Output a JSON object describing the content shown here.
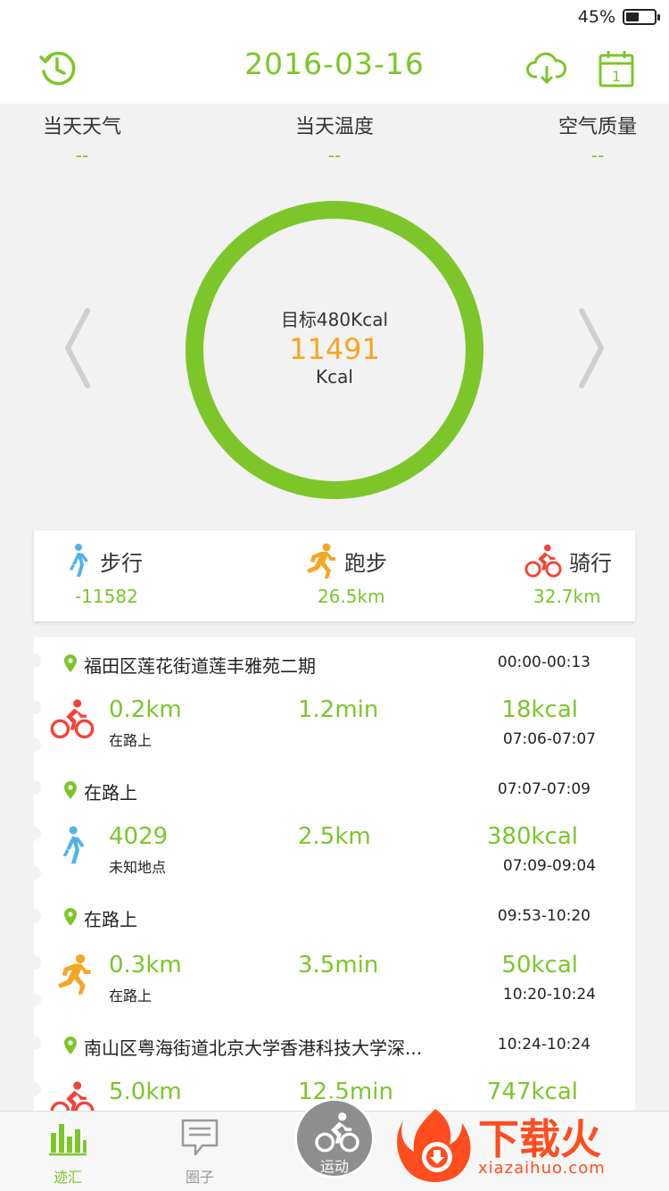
{
  "status": {
    "battery": "45%",
    "battery_level": 0.45
  },
  "header": {
    "date": "2016-03-16",
    "left_icon": "history-clock-icon",
    "right_icons": [
      "cloud-download-icon",
      "calendar-icon"
    ],
    "calendar_day": "1"
  },
  "weather": [
    {
      "label": "当天天气",
      "value": "--"
    },
    {
      "label": "当天温度",
      "value": "--"
    },
    {
      "label": "空气质量",
      "value": "--"
    }
  ],
  "calories": {
    "goal": "目标480Kcal",
    "value": "11491",
    "unit": "Kcal",
    "progress": 1.0
  },
  "summary": [
    {
      "icon": "walking-icon",
      "label": "步行",
      "value": "-11582",
      "color": "#4fb3e8"
    },
    {
      "icon": "running-icon",
      "label": "跑步",
      "value": "26.5km",
      "color": "#f5a623"
    },
    {
      "icon": "cycling-icon",
      "label": "骑行",
      "value": "32.7km",
      "color": "#f44336"
    }
  ],
  "timeline": [
    {
      "location": "福田区莲花街道莲丰雅苑二期",
      "loc_time": "00:00-00:13",
      "activity": {
        "icon": "cycling-icon",
        "main": "0.2km",
        "sub": "在路上",
        "mid": "1.2min",
        "right": "18kcal",
        "time": "07:06-07:07"
      }
    },
    {
      "location": "在路上",
      "loc_time": "07:07-07:09",
      "activity": {
        "icon": "walking-icon",
        "main": "4029",
        "sub": "未知地点",
        "mid": "2.5km",
        "right": "380kcal",
        "time": "07:09-09:04"
      }
    },
    {
      "location": "在路上",
      "loc_time": "09:53-10:20",
      "activity": {
        "icon": "running-icon",
        "main": "0.3km",
        "sub": "在路上",
        "mid": "3.5min",
        "right": "50kcal",
        "time": "10:20-10:24"
      }
    },
    {
      "location": "南山区粤海街道北京大学香港科技大学深...",
      "loc_time": "10:24-10:24",
      "activity": {
        "icon": "cycling-icon",
        "main": "5.0km",
        "sub": "",
        "mid": "12.5min",
        "right": "747kcal",
        "time": ""
      }
    }
  ],
  "tabs": [
    {
      "label": "迹汇",
      "icon": "bar-chart-icon",
      "active": true
    },
    {
      "label": "圈子",
      "icon": "chat-bubble-icon",
      "active": false
    },
    {
      "label": "运动",
      "icon": "cycling-icon",
      "active": false
    }
  ],
  "watermark": {
    "text": "下载火",
    "url": "xiazaihuo.com"
  },
  "colors": {
    "accent": "#7cc62a",
    "orange": "#f5a623",
    "blue": "#4fb3e8",
    "red": "#f44336"
  }
}
